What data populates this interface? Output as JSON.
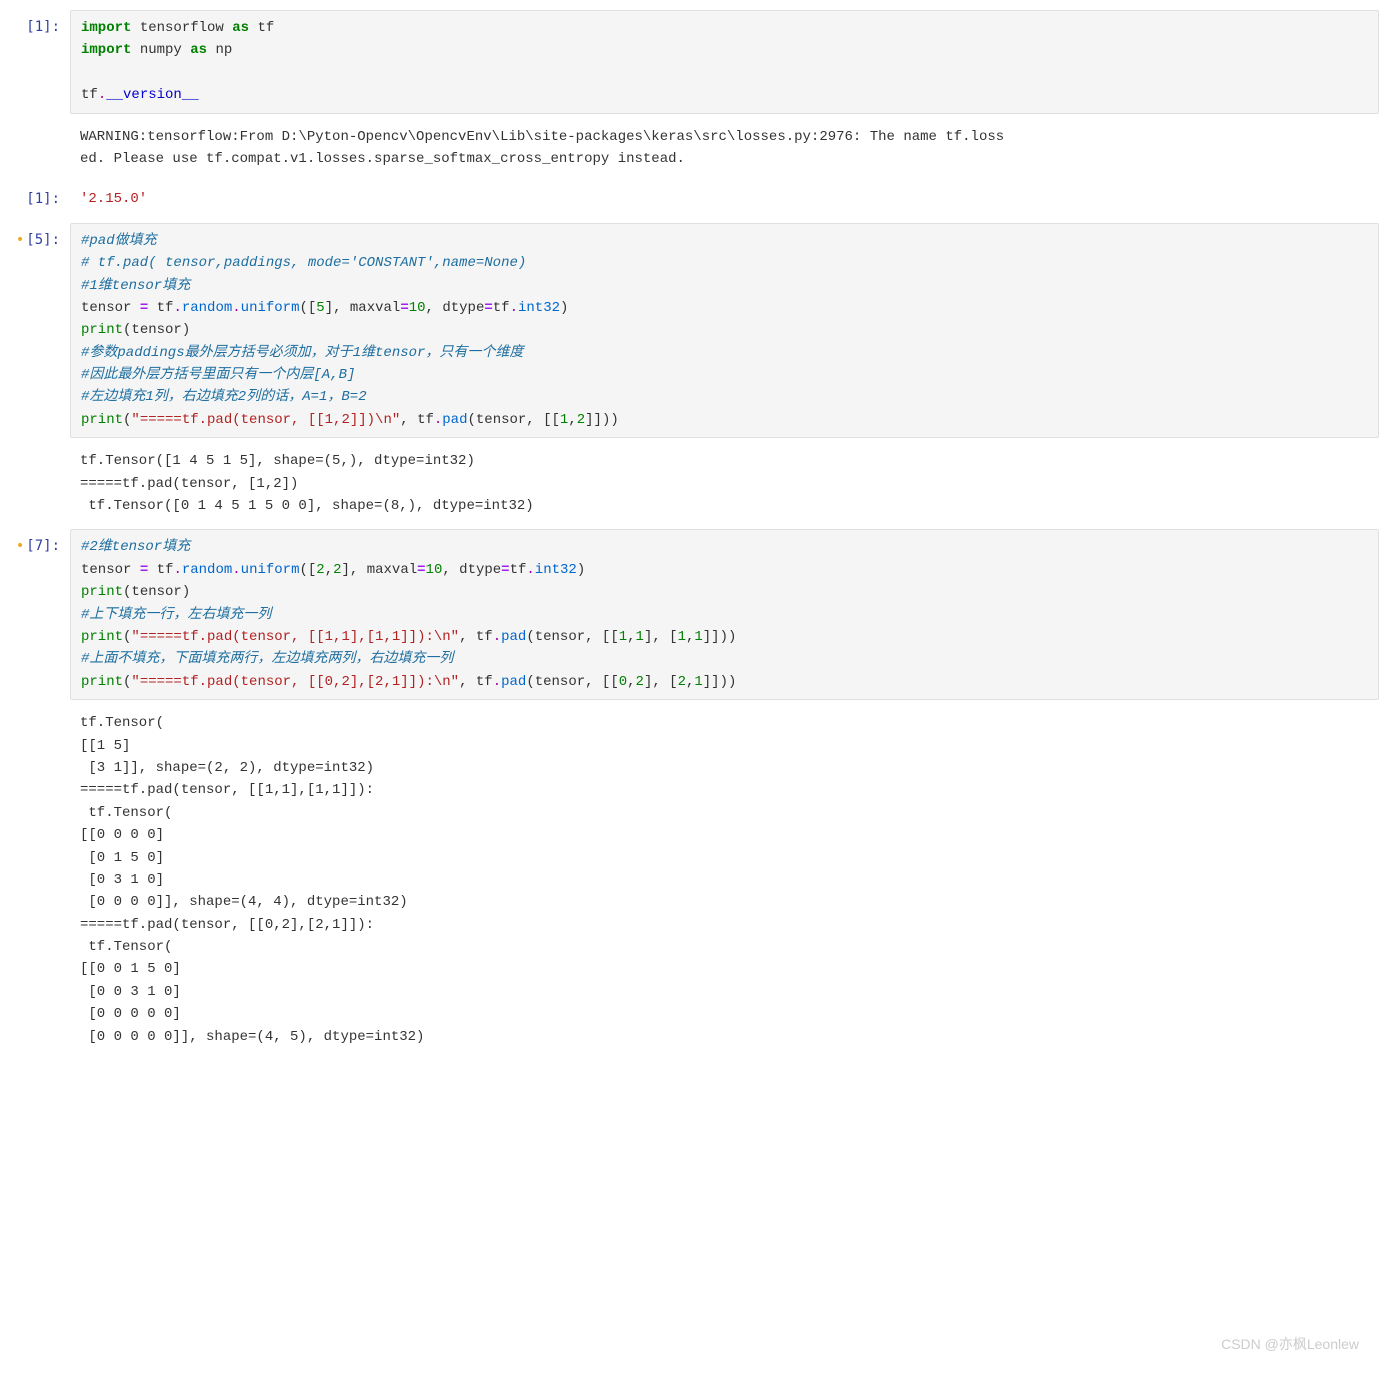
{
  "cells": {
    "c1": {
      "prompt": "[1]:",
      "code_lines": {
        "l1_pre": "import",
        "l1_mid": " tensorflow ",
        "l1_as": "as",
        "l1_post": " tf",
        "l2_pre": "import",
        "l2_mid": " numpy ",
        "l2_as": "as",
        "l2_post": " np",
        "l3": "",
        "l4_pre": "tf",
        "l4_dot": ".",
        "l4_dunder": "__version__"
      }
    },
    "c1_warn": {
      "text": "WARNING:tensorflow:From D:\\Pyton-Opencv\\OpencvEnv\\Lib\\site-packages\\keras\\src\\losses.py:2976: The name tf.loss\ned. Please use tf.compat.v1.losses.sparse_softmax_cross_entropy instead."
    },
    "c1_out": {
      "prompt": "[1]:",
      "text": "'2.15.0'"
    },
    "c5": {
      "prompt": "[5]:",
      "cmt1": "#pad做填充",
      "cmt2": "# tf.pad( tensor,paddings, mode='CONSTANT',name=None)",
      "cmt3": "#1维tensor填充",
      "l4_a": "tensor ",
      "l4_eq": "=",
      "l4_b": " tf",
      "l4_d1": ".",
      "l4_c": "random",
      "l4_d2": ".",
      "l4_d": "uniform",
      "l4_e": "([",
      "l4_n1": "5",
      "l4_f": "], maxval",
      "l4_eq2": "=",
      "l4_n2": "10",
      "l4_g": ", dtype",
      "l4_eq3": "=",
      "l4_h": "tf",
      "l4_d3": ".",
      "l4_i": "int32",
      "l4_j": ")",
      "l5_a": "print",
      "l5_b": "(tensor)",
      "cmt6": "#参数paddings最外层方括号必须加，对于1维tensor，只有一个维度",
      "cmt7": "#因此最外层方括号里面只有一个内层[A,B]",
      "cmt8": "#左边填充1列，右边填充2列的话，A=1，B=2",
      "l9_a": "print",
      "l9_b": "(",
      "l9_str": "\"=====tf.pad(tensor, [[1,2]])\\n\"",
      "l9_c": ", tf",
      "l9_d1": ".",
      "l9_d": "pad",
      "l9_e": "(tensor, [[",
      "l9_n1": "1",
      "l9_f": ",",
      "l9_n2": "2",
      "l9_g": "]]))"
    },
    "c5_out": {
      "text": "tf.Tensor([1 4 5 1 5], shape=(5,), dtype=int32)\n=====tf.pad(tensor, [1,2])\n tf.Tensor([0 1 4 5 1 5 0 0], shape=(8,), dtype=int32)"
    },
    "c7": {
      "prompt": "[7]:",
      "cmt1": "#2维tensor填充",
      "l2_a": "tensor ",
      "l2_eq": "=",
      "l2_b": " tf",
      "l2_d1": ".",
      "l2_c": "random",
      "l2_d2": ".",
      "l2_d": "uniform",
      "l2_e": "([",
      "l2_n1": "2",
      "l2_f": ",",
      "l2_n2": "2",
      "l2_g": "], maxval",
      "l2_eq2": "=",
      "l2_n3": "10",
      "l2_h": ", dtype",
      "l2_eq3": "=",
      "l2_i": "tf",
      "l2_d3": ".",
      "l2_j": "int32",
      "l2_k": ")",
      "l3_a": "print",
      "l3_b": "(tensor)",
      "cmt4": "#上下填充一行，左右填充一列",
      "l5_a": "print",
      "l5_b": "(",
      "l5_str": "\"=====tf.pad(tensor, [[1,1],[1,1]]):\\n\"",
      "l5_c": ", tf",
      "l5_d1": ".",
      "l5_d": "pad",
      "l5_e": "(tensor, [[",
      "l5_n1": "1",
      "l5_f": ",",
      "l5_n2": "1",
      "l5_g": "], [",
      "l5_n3": "1",
      "l5_h": ",",
      "l5_n4": "1",
      "l5_i": "]]))",
      "cmt6": "#上面不填充，下面填充两行，左边填充两列，右边填充一列",
      "l7_a": "print",
      "l7_b": "(",
      "l7_str": "\"=====tf.pad(tensor, [[0,2],[2,1]]):\\n\"",
      "l7_c": ", tf",
      "l7_d1": ".",
      "l7_d": "pad",
      "l7_e": "(tensor, [[",
      "l7_n1": "0",
      "l7_f": ",",
      "l7_n2": "2",
      "l7_g": "], [",
      "l7_n3": "2",
      "l7_h": ",",
      "l7_n4": "1",
      "l7_i": "]]))"
    },
    "c7_out": {
      "text": "tf.Tensor(\n[[1 5]\n [3 1]], shape=(2, 2), dtype=int32)\n=====tf.pad(tensor, [[1,1],[1,1]]):\n tf.Tensor(\n[[0 0 0 0]\n [0 1 5 0]\n [0 3 1 0]\n [0 0 0 0]], shape=(4, 4), dtype=int32)\n=====tf.pad(tensor, [[0,2],[2,1]]):\n tf.Tensor(\n[[0 0 1 5 0]\n [0 0 3 1 0]\n [0 0 0 0 0]\n [0 0 0 0 0]], shape=(4, 5), dtype=int32)"
    }
  },
  "watermark": "CSDN @亦枫Leonlew"
}
